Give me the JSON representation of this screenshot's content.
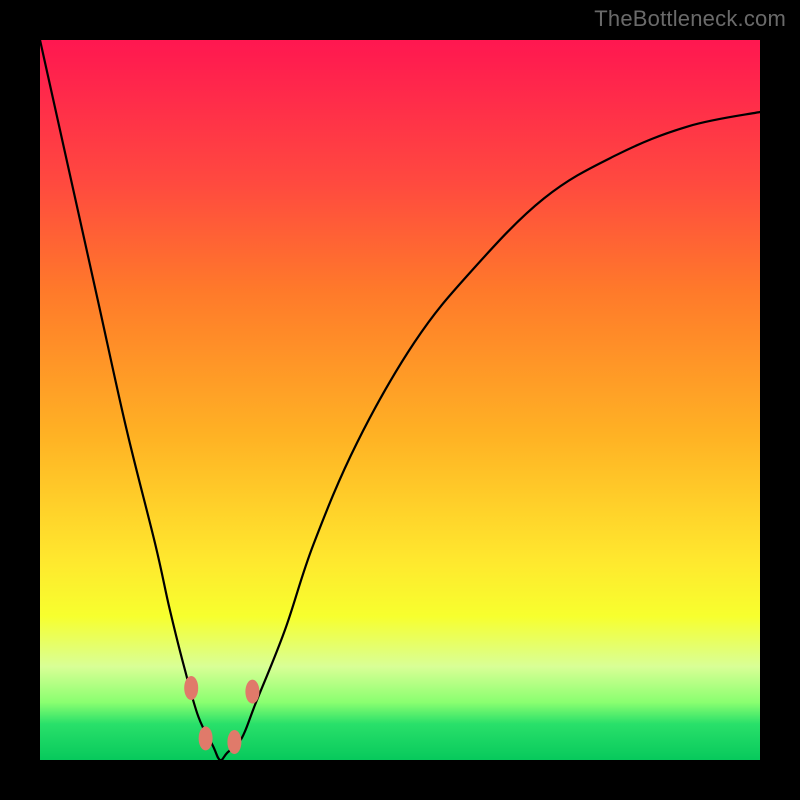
{
  "watermark": "TheBottleneck.com",
  "colors": {
    "frame": "#000000",
    "curve": "#000000",
    "lozenge": "#e07a6a",
    "gradient_top": "#ff1750",
    "gradient_mid1": "#ff7a2a",
    "gradient_mid2": "#ffe72e",
    "gradient_bottom": "#07c95c"
  },
  "chart_data": {
    "type": "line",
    "title": "",
    "xlabel": "",
    "ylabel": "",
    "xlim": [
      0,
      100
    ],
    "ylim": [
      0,
      100
    ],
    "note": "Axes unlabeled; values approximated from curve geometry. y=0 at bottom (green), y=100 at top (red). Curve is a V/valley shape with minimum near x≈25, y≈0.",
    "series": [
      {
        "name": "bottleneck-curve",
        "x": [
          0,
          4,
          8,
          12,
          16,
          18,
          20,
          22,
          24,
          25,
          26,
          28,
          30,
          34,
          38,
          44,
          52,
          60,
          70,
          80,
          90,
          100
        ],
        "y": [
          100,
          82,
          64,
          46,
          30,
          21,
          13,
          6,
          2,
          0,
          1,
          3,
          8,
          18,
          30,
          44,
          58,
          68,
          78,
          84,
          88,
          90
        ]
      }
    ],
    "markers": [
      {
        "name": "left-upper",
        "x": 21.0,
        "y": 10.0
      },
      {
        "name": "left-lower",
        "x": 23.0,
        "y": 3.0
      },
      {
        "name": "right-lower",
        "x": 27.0,
        "y": 2.5
      },
      {
        "name": "right-upper",
        "x": 29.5,
        "y": 9.5
      }
    ]
  }
}
